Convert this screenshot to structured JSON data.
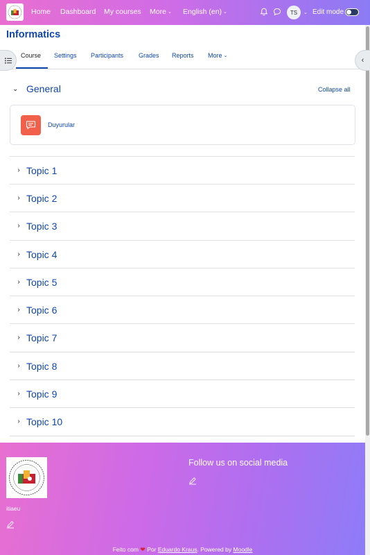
{
  "navbar": {
    "items": [
      {
        "label": "Home"
      },
      {
        "label": "Dashboard"
      },
      {
        "label": "My courses"
      },
      {
        "label": "More"
      },
      {
        "label": "English (en)"
      }
    ],
    "avatar_initials": "TS",
    "edit_mode_label": "Edit mode",
    "edit_mode_on": false,
    "icons": [
      "bell-icon",
      "chat-icon"
    ]
  },
  "course": {
    "title": "Informatics",
    "tabs": [
      {
        "label": "Course",
        "active": true
      },
      {
        "label": "Settings"
      },
      {
        "label": "Participants"
      },
      {
        "label": "Grades"
      },
      {
        "label": "Reports"
      },
      {
        "label": "More"
      }
    ]
  },
  "general": {
    "title": "General",
    "collapse_all_label": "Collapse all",
    "activity": {
      "name": "Duyurular",
      "icon": "forum-icon",
      "icon_color": "#f0604b"
    }
  },
  "topics": [
    {
      "name": "Topic 1"
    },
    {
      "name": "Topic 2"
    },
    {
      "name": "Topic 3"
    },
    {
      "name": "Topic 4"
    },
    {
      "name": "Topic 5"
    },
    {
      "name": "Topic 6"
    },
    {
      "name": "Topic 7"
    },
    {
      "name": "Topic 8"
    },
    {
      "name": "Topic 9"
    },
    {
      "name": "Topic 10"
    }
  ],
  "footer": {
    "site_name": "itiaeu",
    "follow_title": "Follow us on social media",
    "credits": {
      "made_with": "Feito com",
      "by": "Por",
      "author": "Eduardo Kraus",
      "powered": ". Powered by",
      "platform": "Moodle"
    }
  },
  "colors": {
    "link": "#0f47ad",
    "navbar_gradient": [
      "#e86fd0",
      "#8b7cf5"
    ],
    "activity_icon": "#f0604b"
  }
}
